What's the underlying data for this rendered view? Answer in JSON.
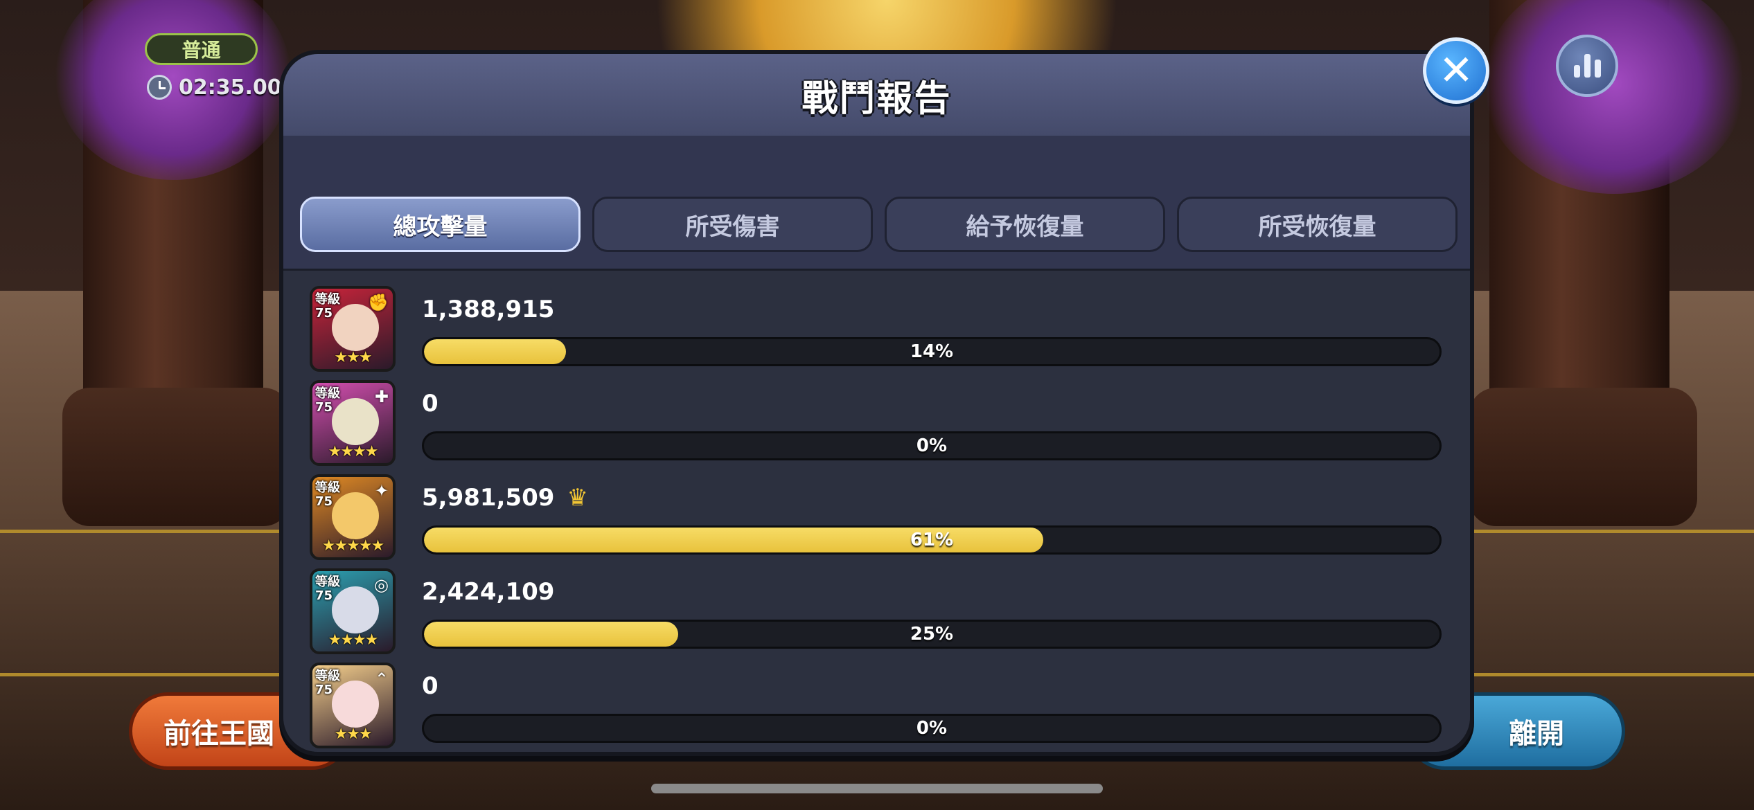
{
  "hud": {
    "difficulty": "普通",
    "timer": "02:35.00"
  },
  "panel": {
    "title": "戰鬥報告",
    "tabs": [
      {
        "label": "總攻擊量",
        "active": true
      },
      {
        "label": "所受傷害",
        "active": false
      },
      {
        "label": "給予恢復量",
        "active": false
      },
      {
        "label": "所受恢復量",
        "active": false
      }
    ],
    "level_label": "等級",
    "rows": [
      {
        "level": "75",
        "score": "1,388,915",
        "percent_label": "14%",
        "fill_fraction": 0.14,
        "stars": "★★★",
        "role_icon": "charge-icon",
        "role_glyph": "✊",
        "top": false,
        "bg": "#c8243a",
        "face": "#f1d3c0"
      },
      {
        "level": "75",
        "score": "0",
        "percent_label": "0%",
        "fill_fraction": 0.0,
        "stars": "★★★★",
        "role_icon": "healing-icon",
        "role_glyph": "✚",
        "top": false,
        "bg": "#d44fb0",
        "face": "#e9e2c8"
      },
      {
        "level": "75",
        "score": "5,981,509",
        "percent_label": "61%",
        "fill_fraction": 0.61,
        "stars": "★★★★★",
        "role_icon": "magic-icon",
        "role_glyph": "✦",
        "top": true,
        "bg": "#e08a24",
        "face": "#f3c86a"
      },
      {
        "level": "75",
        "score": "2,424,109",
        "percent_label": "25%",
        "fill_fraction": 0.25,
        "stars": "★★★★",
        "role_icon": "ranged-icon",
        "role_glyph": "◎",
        "top": false,
        "bg": "#2b9fb0",
        "face": "#d8dbe8"
      },
      {
        "level": "75",
        "score": "0",
        "percent_label": "0%",
        "fill_fraction": 0.0,
        "stars": "★★★",
        "role_icon": "support-icon",
        "role_glyph": "⌃",
        "top": false,
        "bg": "#f5cf8c",
        "face": "#f7dada"
      }
    ]
  },
  "buttons": {
    "kingdom": "前往王國",
    "leave": "離開"
  },
  "colors": {
    "bar_fill": "#e8c23c",
    "active_tab": "#6f82b8",
    "close_button": "#2f86e0"
  },
  "icons": {
    "close": "close-icon",
    "stats": "bar-chart-icon",
    "timer": "clock-icon",
    "top_damage": "crown-icon"
  }
}
